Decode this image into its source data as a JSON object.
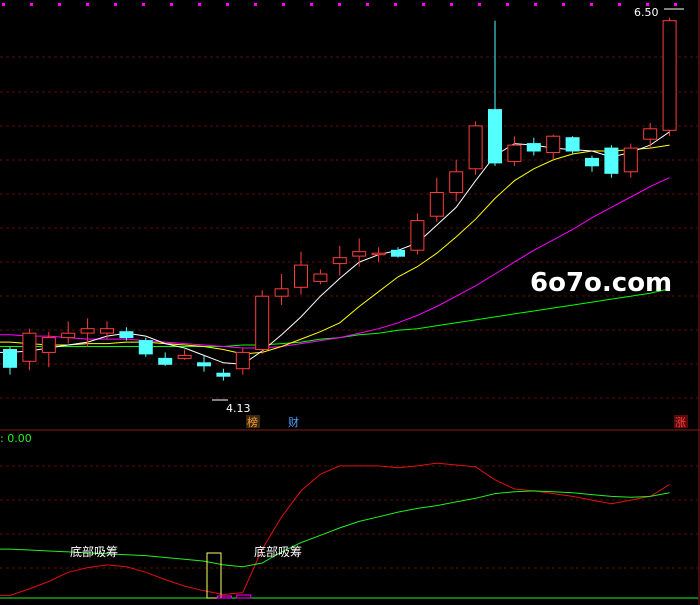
{
  "watermark": "6o7o.com",
  "indicator_readout": ": 0.00",
  "badges": {
    "bang": "榜",
    "cai": "财",
    "zhang": "涨"
  },
  "colors": {
    "bg": "#000000",
    "up": "#ff3c3c",
    "down": "#54ffff",
    "ma5": "#ffffff",
    "ma10": "#ffff00",
    "ma20": "#ff00ff",
    "ma60": "#00ff00",
    "ind_red": "#e01010",
    "ind_green": "#22ee22",
    "signal_box": "#ffff66",
    "grid_dots": "#ff00ff"
  },
  "chart_data": [
    {
      "type": "candlestick",
      "price_range": [
        3.75,
        6.62
      ],
      "high_label": "6.50",
      "low_label": "4.13",
      "candles": [
        {
          "o": 4.26,
          "c": 4.14,
          "h": 4.28,
          "l": 4.09
        },
        {
          "o": 4.18,
          "c": 4.37,
          "h": 4.4,
          "l": 4.12
        },
        {
          "o": 4.24,
          "c": 4.34,
          "h": 4.38,
          "l": 4.14
        },
        {
          "o": 4.34,
          "c": 4.37,
          "h": 4.45,
          "l": 4.3
        },
        {
          "o": 4.37,
          "c": 4.4,
          "h": 4.47,
          "l": 4.28
        },
        {
          "o": 4.37,
          "c": 4.4,
          "h": 4.45,
          "l": 4.33
        },
        {
          "o": 4.38,
          "c": 4.34,
          "h": 4.41,
          "l": 4.32
        },
        {
          "o": 4.32,
          "c": 4.23,
          "h": 4.34,
          "l": 4.21
        },
        {
          "o": 4.2,
          "c": 4.16,
          "h": 4.24,
          "l": 4.15
        },
        {
          "o": 4.2,
          "c": 4.22,
          "h": 4.26,
          "l": 4.19
        },
        {
          "o": 4.17,
          "c": 4.15,
          "h": 4.22,
          "l": 4.11
        },
        {
          "o": 4.1,
          "c": 4.08,
          "h": 4.13,
          "l": 4.05
        },
        {
          "o": 4.13,
          "c": 4.24,
          "h": 4.27,
          "l": 4.09
        },
        {
          "o": 4.26,
          "c": 4.62,
          "h": 4.66,
          "l": 4.23
        },
        {
          "o": 4.62,
          "c": 4.67,
          "h": 4.77,
          "l": 4.56
        },
        {
          "o": 4.68,
          "c": 4.83,
          "h": 4.92,
          "l": 4.63
        },
        {
          "o": 4.72,
          "c": 4.77,
          "h": 4.8,
          "l": 4.7
        },
        {
          "o": 4.84,
          "c": 4.88,
          "h": 4.96,
          "l": 4.76
        },
        {
          "o": 4.89,
          "c": 4.92,
          "h": 5.01,
          "l": 4.82
        },
        {
          "o": 4.9,
          "c": 4.91,
          "h": 4.95,
          "l": 4.85
        },
        {
          "o": 4.93,
          "c": 4.89,
          "h": 4.95,
          "l": 4.88
        },
        {
          "o": 4.93,
          "c": 5.13,
          "h": 5.18,
          "l": 4.9
        },
        {
          "o": 5.16,
          "c": 5.32,
          "h": 5.42,
          "l": 5.12
        },
        {
          "o": 5.32,
          "c": 5.46,
          "h": 5.54,
          "l": 5.26
        },
        {
          "o": 5.48,
          "c": 5.77,
          "h": 5.8,
          "l": 5.44
        },
        {
          "o": 5.88,
          "c": 5.52,
          "h": 6.48,
          "l": 5.5
        },
        {
          "o": 5.53,
          "c": 5.64,
          "h": 5.7,
          "l": 5.5
        },
        {
          "o": 5.65,
          "c": 5.6,
          "h": 5.69,
          "l": 5.57
        },
        {
          "o": 5.59,
          "c": 5.7,
          "h": 5.71,
          "l": 5.54
        },
        {
          "o": 5.69,
          "c": 5.6,
          "h": 5.7,
          "l": 5.58
        },
        {
          "o": 5.55,
          "c": 5.5,
          "h": 5.57,
          "l": 5.46
        },
        {
          "o": 5.62,
          "c": 5.45,
          "h": 5.64,
          "l": 5.42
        },
        {
          "o": 5.46,
          "c": 5.62,
          "h": 5.65,
          "l": 5.42
        },
        {
          "o": 5.68,
          "c": 5.75,
          "h": 5.79,
          "l": 5.62
        },
        {
          "o": 5.74,
          "c": 6.48,
          "h": 6.5,
          "l": 5.7
        }
      ],
      "ma5": [
        4.24,
        4.25,
        4.27,
        4.29,
        4.31,
        4.35,
        4.37,
        4.35,
        4.3,
        4.27,
        4.22,
        4.17,
        4.16,
        4.25,
        4.36,
        4.48,
        4.62,
        4.74,
        4.85,
        4.9,
        4.93,
        4.98,
        5.1,
        5.22,
        5.4,
        5.57,
        5.65,
        5.64,
        5.62,
        5.61,
        5.6,
        5.56,
        5.59,
        5.64,
        5.73
      ],
      "ma10": [
        4.31,
        4.3,
        4.29,
        4.29,
        4.3,
        4.3,
        4.31,
        4.31,
        4.3,
        4.29,
        4.28,
        4.26,
        4.23,
        4.24,
        4.28,
        4.33,
        4.38,
        4.44,
        4.55,
        4.65,
        4.75,
        4.82,
        4.91,
        5.02,
        5.14,
        5.28,
        5.4,
        5.48,
        5.54,
        5.58,
        5.6,
        5.6,
        5.61,
        5.62,
        5.64
      ],
      "ma20": [
        4.36,
        4.35,
        4.35,
        4.34,
        4.33,
        4.33,
        4.33,
        4.32,
        4.31,
        4.3,
        4.29,
        4.28,
        4.27,
        4.27,
        4.28,
        4.3,
        4.32,
        4.34,
        4.37,
        4.4,
        4.44,
        4.49,
        4.55,
        4.62,
        4.69,
        4.77,
        4.85,
        4.93,
        5.0,
        5.07,
        5.15,
        5.22,
        5.29,
        5.36,
        5.42
      ],
      "ma60": [
        4.28,
        4.28,
        4.28,
        4.28,
        4.28,
        4.28,
        4.28,
        4.28,
        4.28,
        4.28,
        4.28,
        4.28,
        4.29,
        4.29,
        4.3,
        4.31,
        4.33,
        4.34,
        4.36,
        4.37,
        4.39,
        4.4,
        4.42,
        4.44,
        4.46,
        4.48,
        4.5,
        4.52,
        4.54,
        4.56,
        4.58,
        4.6,
        4.62,
        4.64,
        4.67
      ]
    },
    {
      "type": "line",
      "y_range": [
        0,
        100
      ],
      "series": [
        {
          "values": [
            5,
            12,
            20,
            30,
            35,
            38,
            36,
            30,
            22,
            15,
            10,
            6,
            8,
            55,
            90,
            118,
            136,
            145,
            145,
            145,
            143,
            145,
            148,
            146,
            144,
            130,
            120,
            118,
            115,
            112,
            108,
            104,
            108,
            112,
            125
          ]
        },
        {
          "values": [
            55,
            54,
            53,
            52,
            51,
            50,
            49,
            48,
            46,
            44,
            42,
            38,
            36,
            40,
            52,
            62,
            70,
            78,
            85,
            90,
            95,
            99,
            102,
            106,
            110,
            115,
            117,
            118,
            117,
            116,
            114,
            112,
            111,
            112,
            116
          ]
        }
      ],
      "annotations": [
        "底部吸筹",
        "底部吸筹"
      ]
    }
  ]
}
